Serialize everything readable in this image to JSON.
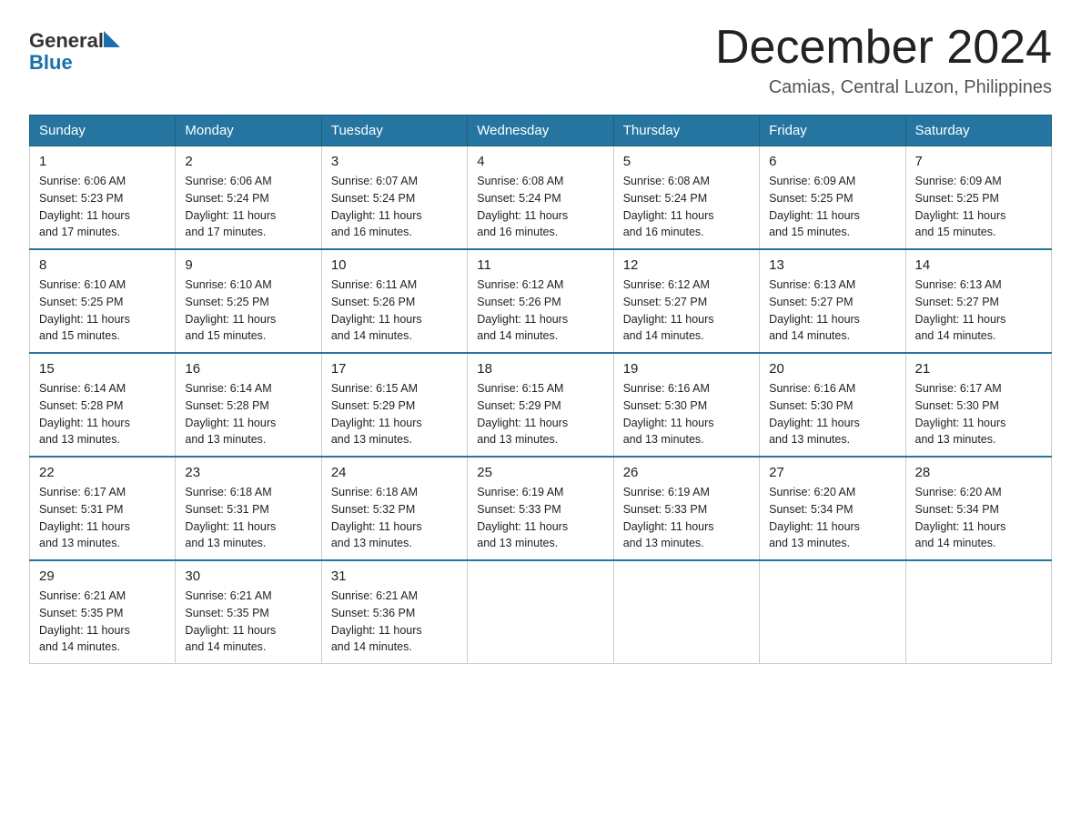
{
  "header": {
    "logo_general": "General",
    "logo_blue": "Blue",
    "main_title": "December 2024",
    "subtitle": "Camias, Central Luzon, Philippines"
  },
  "days_of_week": [
    "Sunday",
    "Monday",
    "Tuesday",
    "Wednesday",
    "Thursday",
    "Friday",
    "Saturday"
  ],
  "weeks": [
    [
      {
        "day": "1",
        "sunrise": "6:06 AM",
        "sunset": "5:23 PM",
        "daylight": "11 hours and 17 minutes."
      },
      {
        "day": "2",
        "sunrise": "6:06 AM",
        "sunset": "5:24 PM",
        "daylight": "11 hours and 17 minutes."
      },
      {
        "day": "3",
        "sunrise": "6:07 AM",
        "sunset": "5:24 PM",
        "daylight": "11 hours and 16 minutes."
      },
      {
        "day": "4",
        "sunrise": "6:08 AM",
        "sunset": "5:24 PM",
        "daylight": "11 hours and 16 minutes."
      },
      {
        "day": "5",
        "sunrise": "6:08 AM",
        "sunset": "5:24 PM",
        "daylight": "11 hours and 16 minutes."
      },
      {
        "day": "6",
        "sunrise": "6:09 AM",
        "sunset": "5:25 PM",
        "daylight": "11 hours and 15 minutes."
      },
      {
        "day": "7",
        "sunrise": "6:09 AM",
        "sunset": "5:25 PM",
        "daylight": "11 hours and 15 minutes."
      }
    ],
    [
      {
        "day": "8",
        "sunrise": "6:10 AM",
        "sunset": "5:25 PM",
        "daylight": "11 hours and 15 minutes."
      },
      {
        "day": "9",
        "sunrise": "6:10 AM",
        "sunset": "5:25 PM",
        "daylight": "11 hours and 15 minutes."
      },
      {
        "day": "10",
        "sunrise": "6:11 AM",
        "sunset": "5:26 PM",
        "daylight": "11 hours and 14 minutes."
      },
      {
        "day": "11",
        "sunrise": "6:12 AM",
        "sunset": "5:26 PM",
        "daylight": "11 hours and 14 minutes."
      },
      {
        "day": "12",
        "sunrise": "6:12 AM",
        "sunset": "5:27 PM",
        "daylight": "11 hours and 14 minutes."
      },
      {
        "day": "13",
        "sunrise": "6:13 AM",
        "sunset": "5:27 PM",
        "daylight": "11 hours and 14 minutes."
      },
      {
        "day": "14",
        "sunrise": "6:13 AM",
        "sunset": "5:27 PM",
        "daylight": "11 hours and 14 minutes."
      }
    ],
    [
      {
        "day": "15",
        "sunrise": "6:14 AM",
        "sunset": "5:28 PM",
        "daylight": "11 hours and 13 minutes."
      },
      {
        "day": "16",
        "sunrise": "6:14 AM",
        "sunset": "5:28 PM",
        "daylight": "11 hours and 13 minutes."
      },
      {
        "day": "17",
        "sunrise": "6:15 AM",
        "sunset": "5:29 PM",
        "daylight": "11 hours and 13 minutes."
      },
      {
        "day": "18",
        "sunrise": "6:15 AM",
        "sunset": "5:29 PM",
        "daylight": "11 hours and 13 minutes."
      },
      {
        "day": "19",
        "sunrise": "6:16 AM",
        "sunset": "5:30 PM",
        "daylight": "11 hours and 13 minutes."
      },
      {
        "day": "20",
        "sunrise": "6:16 AM",
        "sunset": "5:30 PM",
        "daylight": "11 hours and 13 minutes."
      },
      {
        "day": "21",
        "sunrise": "6:17 AM",
        "sunset": "5:30 PM",
        "daylight": "11 hours and 13 minutes."
      }
    ],
    [
      {
        "day": "22",
        "sunrise": "6:17 AM",
        "sunset": "5:31 PM",
        "daylight": "11 hours and 13 minutes."
      },
      {
        "day": "23",
        "sunrise": "6:18 AM",
        "sunset": "5:31 PM",
        "daylight": "11 hours and 13 minutes."
      },
      {
        "day": "24",
        "sunrise": "6:18 AM",
        "sunset": "5:32 PM",
        "daylight": "11 hours and 13 minutes."
      },
      {
        "day": "25",
        "sunrise": "6:19 AM",
        "sunset": "5:33 PM",
        "daylight": "11 hours and 13 minutes."
      },
      {
        "day": "26",
        "sunrise": "6:19 AM",
        "sunset": "5:33 PM",
        "daylight": "11 hours and 13 minutes."
      },
      {
        "day": "27",
        "sunrise": "6:20 AM",
        "sunset": "5:34 PM",
        "daylight": "11 hours and 13 minutes."
      },
      {
        "day": "28",
        "sunrise": "6:20 AM",
        "sunset": "5:34 PM",
        "daylight": "11 hours and 14 minutes."
      }
    ],
    [
      {
        "day": "29",
        "sunrise": "6:21 AM",
        "sunset": "5:35 PM",
        "daylight": "11 hours and 14 minutes."
      },
      {
        "day": "30",
        "sunrise": "6:21 AM",
        "sunset": "5:35 PM",
        "daylight": "11 hours and 14 minutes."
      },
      {
        "day": "31",
        "sunrise": "6:21 AM",
        "sunset": "5:36 PM",
        "daylight": "11 hours and 14 minutes."
      },
      null,
      null,
      null,
      null
    ]
  ],
  "labels": {
    "sunrise": "Sunrise:",
    "sunset": "Sunset:",
    "daylight": "Daylight:"
  }
}
